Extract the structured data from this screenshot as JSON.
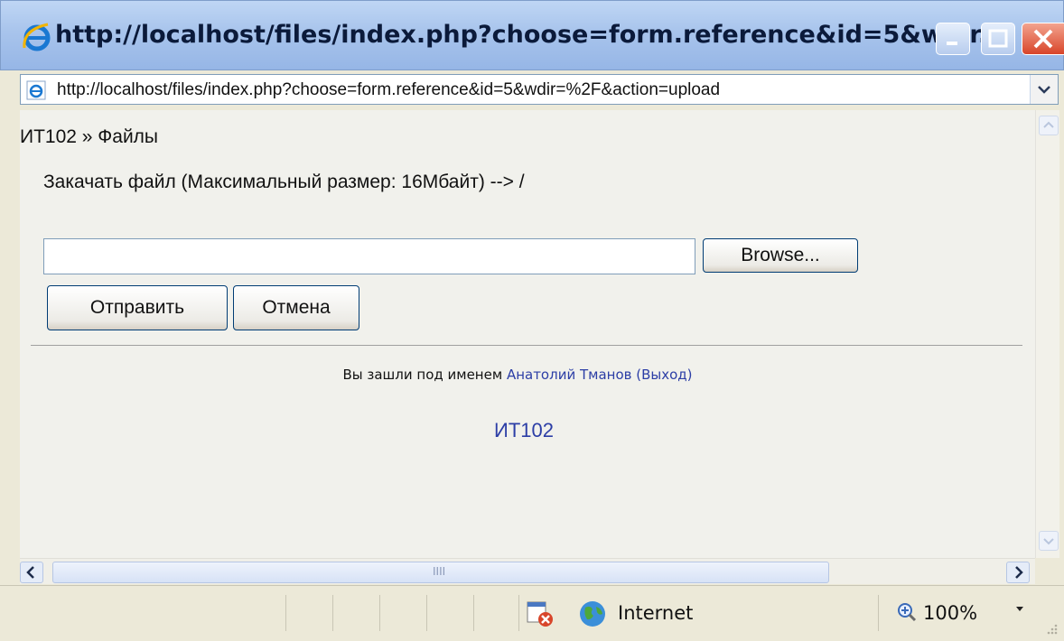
{
  "window": {
    "title": "http://localhost/files/index.php?choose=form.reference&id=5&wdir...",
    "address": "http://localhost/files/index.php?choose=form.reference&id=5&wdir=%2F&action=upload"
  },
  "page": {
    "breadcrumb": "ИТ102 » Файлы",
    "upload_title": "Закачать файл (Максимальный размер: 16Мбайт) --> /",
    "file_value": "",
    "browse_label": "Browse...",
    "submit_label": "Отправить",
    "cancel_label": "Отмена",
    "login_prefix": "Вы зашли под именем",
    "user_name": "Анатолий Тманов",
    "logout_label": "(Выход)",
    "home_link": "ИТ102"
  },
  "statusbar": {
    "zone": "Internet",
    "zoom": "100%"
  },
  "scrollbar": {
    "grip": "IIII"
  },
  "icons": {
    "title_icon": "ie-icon",
    "address_icon": "ie-page-icon",
    "zone_icon": "globe-icon",
    "blocked_icon": "blocked-content-icon",
    "zoom_icon": "zoom-icon"
  },
  "colors": {
    "link": "#2c3ea6",
    "titlebar": "#a8c4ec",
    "close_button": "#d8452a",
    "chrome": "#ece9d8"
  }
}
